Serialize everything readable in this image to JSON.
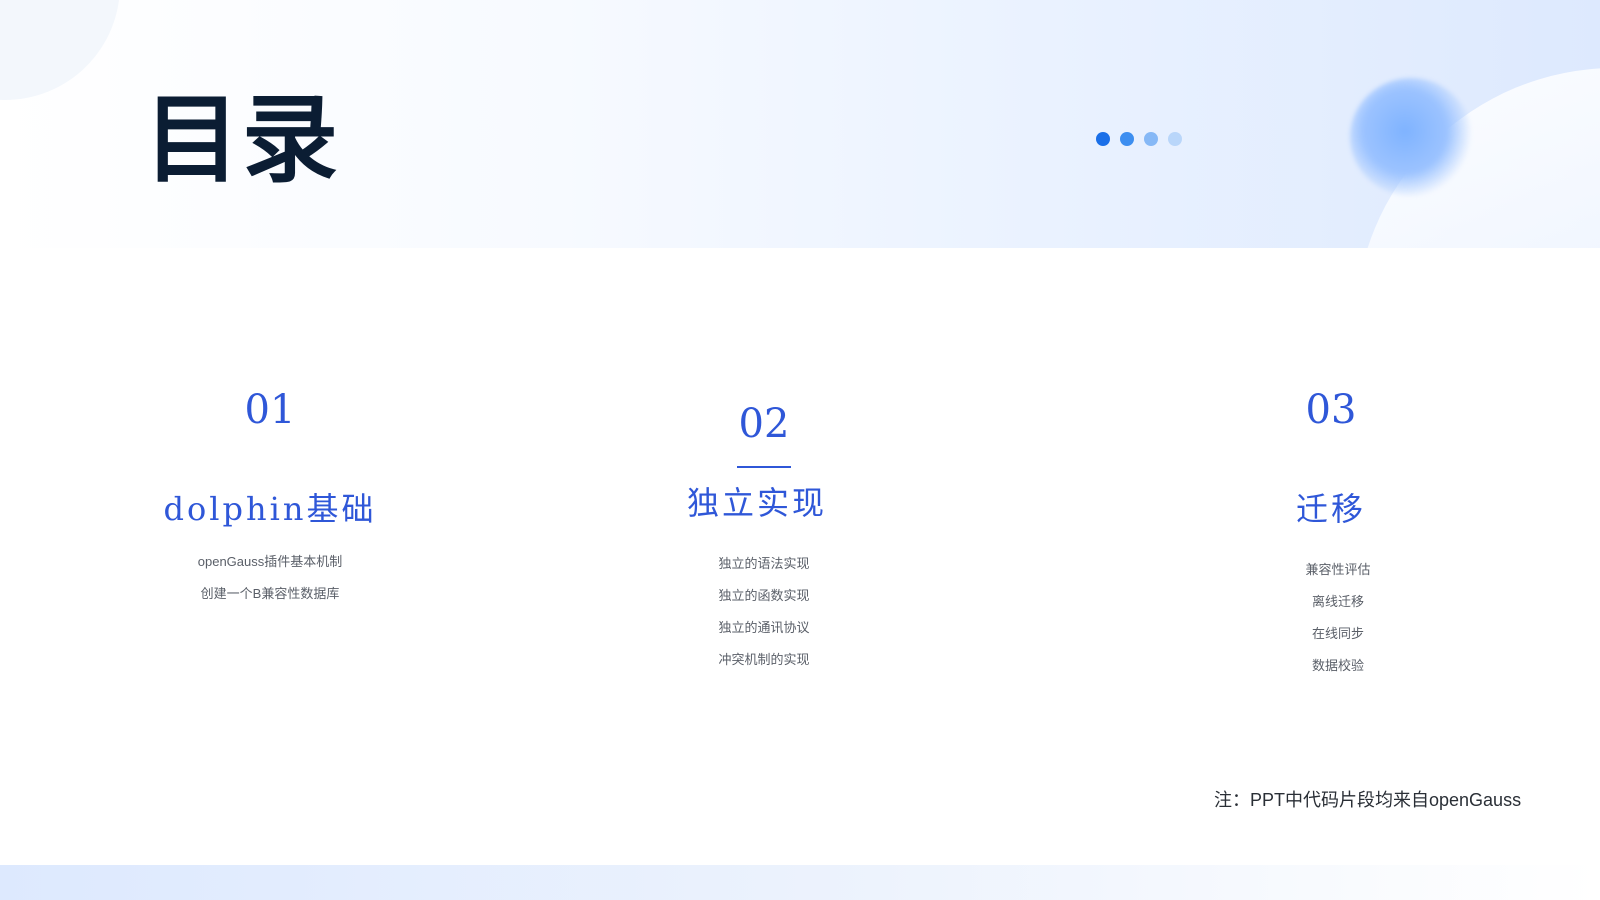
{
  "slide": {
    "title": "目录",
    "note": "注：PPT中代码片段均来自openGauss"
  },
  "indicator": {
    "dot_colors": [
      "#1a6fe8",
      "#3d8ef0",
      "#86b8f6",
      "#b9d6fa"
    ]
  },
  "sections": [
    {
      "number": "01",
      "title": "dolphin基础",
      "items": [
        "openGauss插件基本机制",
        "创建一个B兼容性数据库"
      ]
    },
    {
      "number": "02",
      "title": "独立实现",
      "items": [
        "独立的语法实现",
        "独立的函数实现",
        "独立的通讯协议",
        "冲突机制的实现"
      ]
    },
    {
      "number": "03",
      "title": "迁移",
      "items": [
        "兼容性评估",
        "离线迁移",
        "在线同步",
        "数据校验"
      ]
    }
  ],
  "colors": {
    "accent": "#2f57d8",
    "title": "#0b1d33"
  }
}
